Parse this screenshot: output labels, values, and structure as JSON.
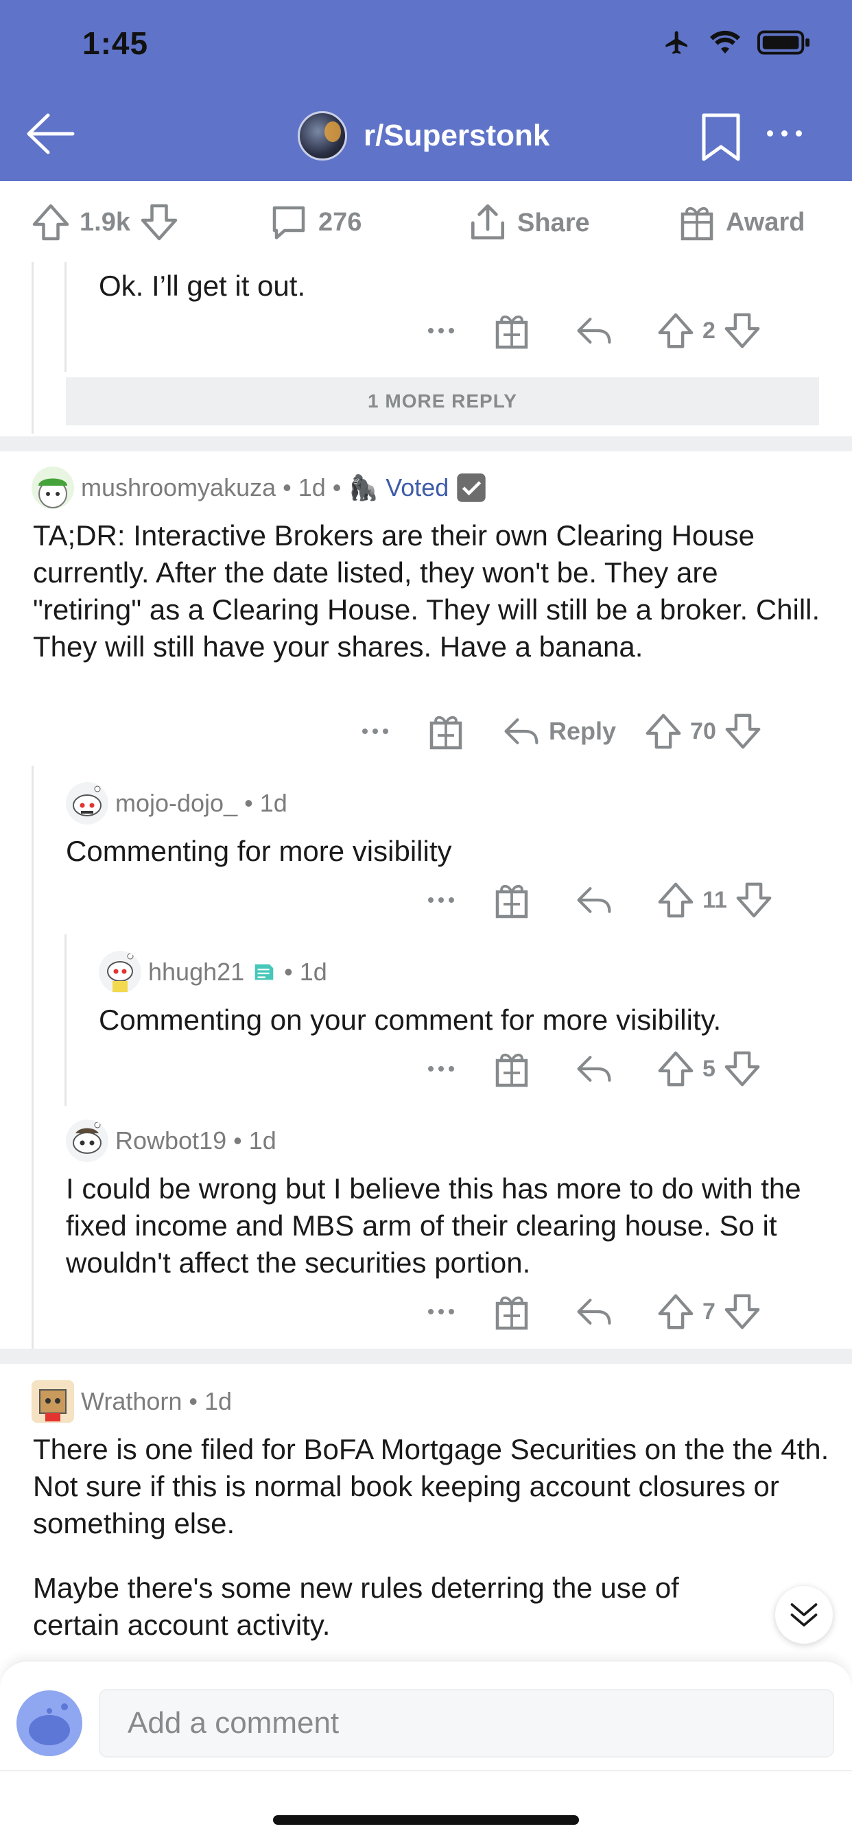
{
  "status_bar": {
    "time": "1:45"
  },
  "header": {
    "subreddit": "r/Superstonk"
  },
  "post_actions": {
    "upvotes": "1.9k",
    "comments": "276",
    "share_label": "Share",
    "award_label": "Award"
  },
  "comments": [
    {
      "id": "c0",
      "text": "Ok. I’ll get it out.",
      "votes": "2"
    },
    {
      "id": "more",
      "more_replies_label": "1 MORE REPLY"
    },
    {
      "id": "c1",
      "author": "mushroomyakuza",
      "age": "1d",
      "flair": "Voted",
      "text": "TA;DR: Interactive Brokers are their own Clearing House currently. After the date listed, they won't be. They are \"retiring\" as a Clearing House. They will still be a broker. Chill. They will still have your shares. Have a banana.",
      "reply_label": "Reply",
      "votes": "70"
    },
    {
      "id": "c2",
      "author": "mojo-dojo_",
      "age": "1d",
      "text": "Commenting for more visibility",
      "votes": "11"
    },
    {
      "id": "c3",
      "author": "hhugh21",
      "age": "1d",
      "text": "Commenting on your comment for more visibility.",
      "votes": "5"
    },
    {
      "id": "c4",
      "author": "Rowbot19",
      "age": "1d",
      "text": "I could be wrong but I believe this has more to do with the fixed income and MBS arm of their clearing house. So it wouldn't affect the securities portion.",
      "votes": "7"
    },
    {
      "id": "c5",
      "author": "Wrathorn",
      "age": "1d",
      "text": "There is one filed for BoFA Mortgage Securities on the the 4th. Not sure if this is normal book keeping account closures or something else.",
      "text2": "Maybe there's some new rules deterring the use of certain account activity."
    }
  ],
  "composer": {
    "placeholder": "Add a comment"
  },
  "colors": {
    "header_bg": "#5f74c8",
    "meta_gray": "#878a8c",
    "flair_blue": "#3e5ca8"
  }
}
